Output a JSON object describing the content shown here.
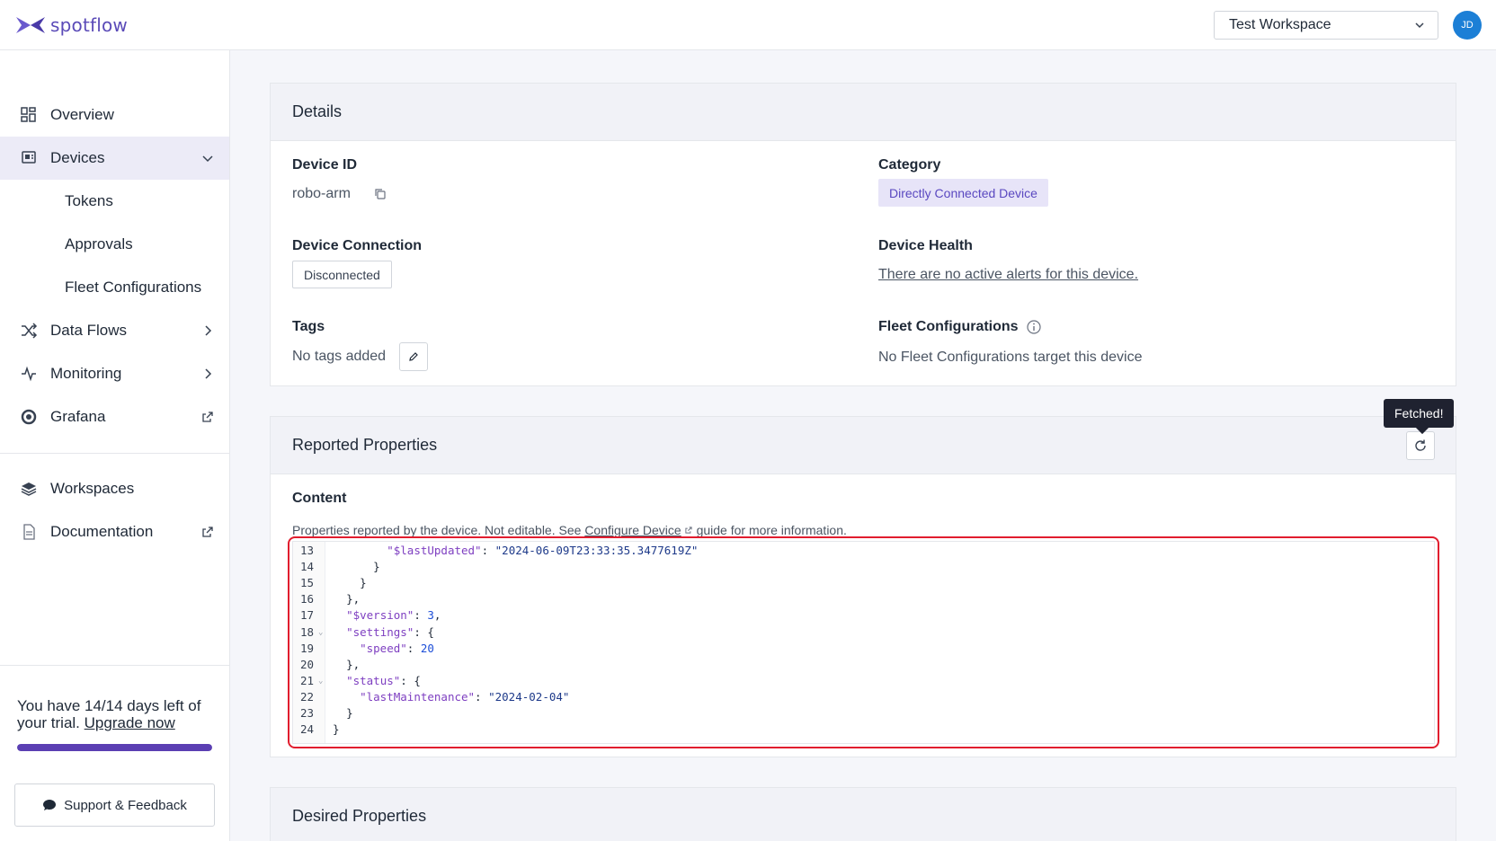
{
  "header": {
    "logo_text": "spotflow",
    "workspace": "Test Workspace",
    "avatar_initials": "JD"
  },
  "sidebar": {
    "items": [
      {
        "label": "Overview",
        "icon": "dashboard-icon"
      },
      {
        "label": "Devices",
        "icon": "devices-icon",
        "active": true
      },
      {
        "label": "Tokens"
      },
      {
        "label": "Approvals"
      },
      {
        "label": "Fleet Configurations"
      },
      {
        "label": "Data Flows",
        "icon": "shuffle-icon"
      },
      {
        "label": "Monitoring",
        "icon": "activity-icon"
      },
      {
        "label": "Grafana",
        "icon": "grafana-icon"
      },
      {
        "label": "Workspaces",
        "icon": "layers-icon"
      },
      {
        "label": "Documentation",
        "icon": "document-icon"
      }
    ],
    "trial_text": "You have 14/14 days left of your trial.",
    "upgrade_label": "Upgrade now",
    "trial_progress": 1.0,
    "support_label": "Support & Feedback"
  },
  "details": {
    "title": "Details",
    "device_id_label": "Device ID",
    "device_id": "robo-arm",
    "category_label": "Category",
    "category": "Directly Connected Device",
    "connection_label": "Device Connection",
    "connection": "Disconnected",
    "health_label": "Device Health",
    "health": "There are no active alerts for this device.",
    "tags_label": "Tags",
    "tags": "No tags added",
    "fleet_label": "Fleet Configurations",
    "fleet": "No Fleet Configurations target this device"
  },
  "reported": {
    "title": "Reported Properties",
    "tooltip": "Fetched!",
    "content_label": "Content",
    "desc_prefix": "Properties reported by the device. Not editable. See ",
    "desc_link": "Configure Device",
    "desc_suffix": " guide for more information.",
    "lines": [
      {
        "n": "13",
        "indent": "        ",
        "key": "\"$lastUpdated\"",
        "sep": ": ",
        "value": "\"2024-06-09T23:33:35.3477619Z\"",
        "vtype": "s",
        "tail": ""
      },
      {
        "n": "14",
        "indent": "      ",
        "key": "",
        "sep": "",
        "value": "",
        "vtype": "",
        "tail": "}"
      },
      {
        "n": "15",
        "indent": "    ",
        "key": "",
        "sep": "",
        "value": "",
        "vtype": "",
        "tail": "}"
      },
      {
        "n": "16",
        "indent": "  ",
        "key": "",
        "sep": "",
        "value": "",
        "vtype": "",
        "tail": "},"
      },
      {
        "n": "17",
        "indent": "  ",
        "key": "\"$version\"",
        "sep": ": ",
        "value": "3",
        "vtype": "n",
        "tail": ","
      },
      {
        "n": "18",
        "indent": "  ",
        "key": "\"settings\"",
        "sep": ": ",
        "value": "",
        "vtype": "",
        "tail": "{",
        "fold": true
      },
      {
        "n": "19",
        "indent": "    ",
        "key": "\"speed\"",
        "sep": ": ",
        "value": "20",
        "vtype": "n",
        "tail": ""
      },
      {
        "n": "20",
        "indent": "  ",
        "key": "",
        "sep": "",
        "value": "",
        "vtype": "",
        "tail": "},"
      },
      {
        "n": "21",
        "indent": "  ",
        "key": "\"status\"",
        "sep": ": ",
        "value": "",
        "vtype": "",
        "tail": "{",
        "fold": true
      },
      {
        "n": "22",
        "indent": "    ",
        "key": "\"lastMaintenance\"",
        "sep": ": ",
        "value": "\"2024-02-04\"",
        "vtype": "s",
        "tail": ""
      },
      {
        "n": "23",
        "indent": "  ",
        "key": "",
        "sep": "",
        "value": "",
        "vtype": "",
        "tail": "}"
      },
      {
        "n": "24",
        "indent": "",
        "key": "",
        "sep": "",
        "value": "",
        "vtype": "",
        "tail": "}"
      }
    ]
  },
  "desired": {
    "title": "Desired Properties"
  },
  "colors": {
    "brand": "#5b4bb8",
    "active_nav_bg": "#ecebf7",
    "category_chip_bg": "#e7e4f8",
    "highlight_outline": "#e11d2e",
    "avatar_bg": "#1c7fd6"
  }
}
